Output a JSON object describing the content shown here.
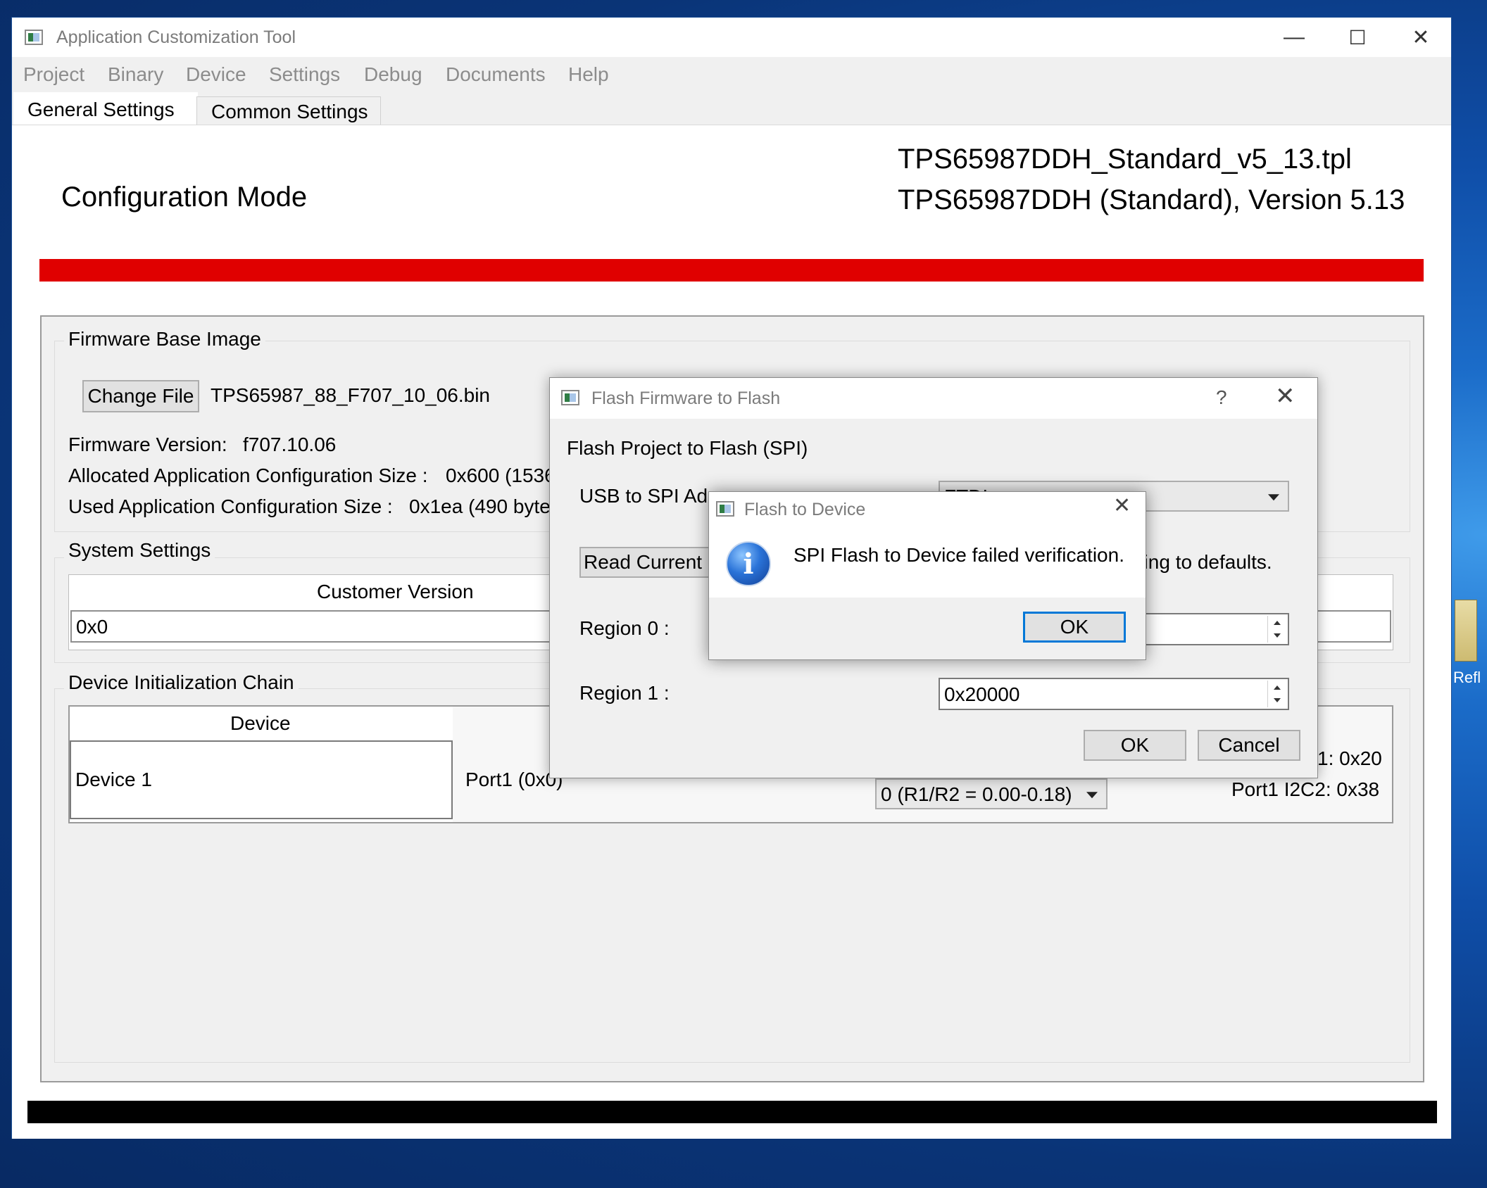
{
  "window": {
    "title": "Application Customization Tool",
    "controls": {
      "minimize": "—",
      "maximize": "☐",
      "close": "✕"
    }
  },
  "menu": [
    "Project",
    "Binary",
    "Device",
    "Settings",
    "Debug",
    "Documents",
    "Help"
  ],
  "tabs": [
    "General Settings",
    "Common Settings"
  ],
  "header": {
    "mode": "Configuration Mode",
    "file": "TPS65987DDH_Standard_v5_13.tpl",
    "version": "TPS65987DDH (Standard), Version 5.13"
  },
  "firmware": {
    "group_title": "Firmware Base Image",
    "change_file": "Change File",
    "filename": "TPS65987_88_F707_10_06.bin",
    "version_label": "Firmware Version:",
    "version_value": "f707.10.06",
    "alloc_label": "Allocated Application Configuration Size :",
    "alloc_value": "0x600 (1536",
    "used_label": "Used Application Configuration Size :",
    "used_value": "0x1ea (490 byte"
  },
  "system": {
    "group_title": "System Settings",
    "header": "Customer Version",
    "value": "0x0"
  },
  "chain": {
    "group_title": "Device Initialization Chain",
    "col_device": "Device",
    "device_name": "Device 1",
    "port": "Port1 (0x0)",
    "select_value": "0 (R1/R2 = 0.00-0.18)",
    "i2c1": "1: 0x20",
    "i2c2": "Port1 I2C2: 0x38"
  },
  "flash_dialog": {
    "title": "Flash Firmware to Flash",
    "help": "?",
    "close": "✕",
    "heading": "Flash Project to Flash (SPI)",
    "adapter_label": "USB to SPI Ada",
    "adapter_value": "FTDI",
    "read_button": "Read Current",
    "defaults_text": "tting to defaults.",
    "region0_label": "Region 0 :",
    "region1_label": "Region 1 :",
    "region1_value": "0x20000",
    "ok": "OK",
    "cancel": "Cancel"
  },
  "msg_dialog": {
    "title": "Flash to Device",
    "close": "✕",
    "icon": "i",
    "message": "SPI Flash to Device failed verification.",
    "ok": "OK"
  },
  "desktop": {
    "icon_label": "Refl"
  }
}
